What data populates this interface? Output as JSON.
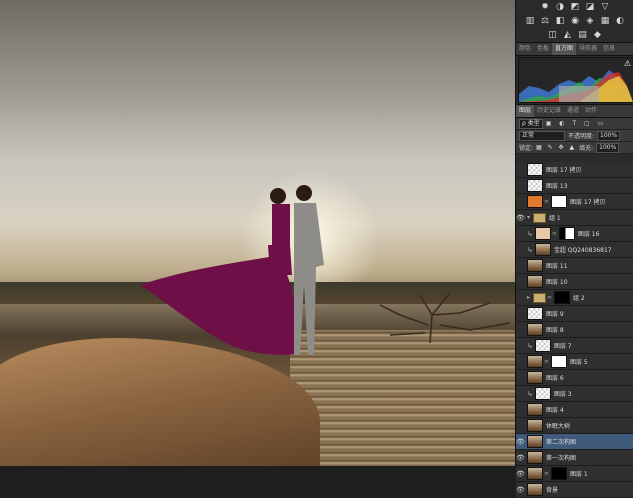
{
  "adjustments_tool_icons": [
    "sun-icon",
    "brightness-icon",
    "curves-icon",
    "exposure-icon",
    "triangle-icon",
    "levels-icon",
    "balance-icon",
    "bw-icon",
    "camera-icon",
    "mixer-icon",
    "grid-icon",
    "invert-icon",
    "posterize-icon",
    "threshold-icon",
    "gradientmap-icon",
    "selectivecolor-icon"
  ],
  "histogram_tabs": [
    "颜色",
    "色板",
    "直方图",
    "导航器",
    "信息"
  ],
  "histogram_active_tab": 2,
  "histogram_warning": "⚠",
  "layers_tabs": [
    "图层",
    "历史记录",
    "通道",
    "动作"
  ],
  "layers_active_tab": 0,
  "filter": {
    "label": "ρ 类型"
  },
  "blend": {
    "mode": "正常",
    "opacity_label": "不透明度:",
    "opacity": "100%"
  },
  "lock": {
    "label": "锁定:",
    "fill_label": "填充:",
    "fill": "100%"
  },
  "layers": [
    {
      "name": "图层 17 拷贝",
      "kind": "chk",
      "visible": false
    },
    {
      "name": "图层 13",
      "kind": "chk",
      "visible": false
    },
    {
      "name": "图层 17 拷贝",
      "kind": "orange",
      "visible": false,
      "mask": "white"
    },
    {
      "name": "组 1",
      "kind": "group",
      "visible": true,
      "open": true
    },
    {
      "name": "图层 16",
      "kind": "skin",
      "visible": false,
      "mask": "black-white",
      "clip": true
    },
    {
      "name": "宝超 QQ240836817",
      "kind": "pic",
      "visible": false,
      "clip": true
    },
    {
      "name": "图层 11",
      "kind": "pic",
      "visible": false
    },
    {
      "name": "图层 10",
      "kind": "pic",
      "visible": false
    },
    {
      "name": "组 2",
      "kind": "group",
      "visible": false,
      "open": false,
      "mask": "black"
    },
    {
      "name": "图层 9",
      "kind": "chk",
      "visible": false
    },
    {
      "name": "图层 8",
      "kind": "pic",
      "visible": false
    },
    {
      "name": "图层 7",
      "kind": "chk",
      "visible": false,
      "clip": true
    },
    {
      "name": "图层 5",
      "kind": "pic",
      "visible": false,
      "mask": "white"
    },
    {
      "name": "图层 6",
      "kind": "pic",
      "visible": false
    },
    {
      "name": "图层 3",
      "kind": "chk",
      "visible": false,
      "clip": true
    },
    {
      "name": "图层 4",
      "kind": "pic",
      "visible": false
    },
    {
      "name": "休眠大树",
      "kind": "pic",
      "visible": false
    },
    {
      "name": "第二次构图",
      "kind": "pic",
      "visible": true,
      "selected": true
    },
    {
      "name": "第一次构图",
      "kind": "pic",
      "visible": true
    },
    {
      "name": "图层 1",
      "kind": "pic",
      "visible": true,
      "mask": "black"
    },
    {
      "name": "背景",
      "kind": "pic",
      "visible": true
    }
  ]
}
